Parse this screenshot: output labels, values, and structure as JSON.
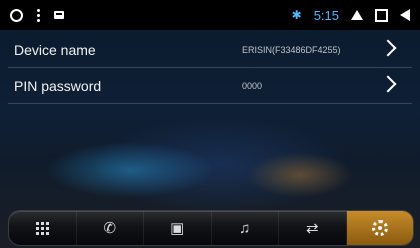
{
  "status_bar": {
    "time": "5:15",
    "icons": [
      "circle-icon",
      "overflow-dots-icon",
      "card-icon",
      "bluetooth-icon",
      "home-icon",
      "recents-icon",
      "back-icon"
    ],
    "accent_color": "#4fb8ff"
  },
  "settings": {
    "rows": [
      {
        "label": "Device name",
        "value": "ERISIN(F33486DF4255)"
      },
      {
        "label": "PIN password",
        "value": "0000"
      }
    ]
  },
  "dock": {
    "items": [
      {
        "name": "apps",
        "icon": "grid-icon"
      },
      {
        "name": "phone",
        "icon": "phone-icon"
      },
      {
        "name": "contacts",
        "icon": "contacts-icon"
      },
      {
        "name": "music",
        "icon": "headphones-icon"
      },
      {
        "name": "transfer",
        "icon": "phone-transfer-icon"
      },
      {
        "name": "settings",
        "icon": "gear-icon",
        "active": true
      }
    ],
    "active_color": "#c78c2a"
  }
}
